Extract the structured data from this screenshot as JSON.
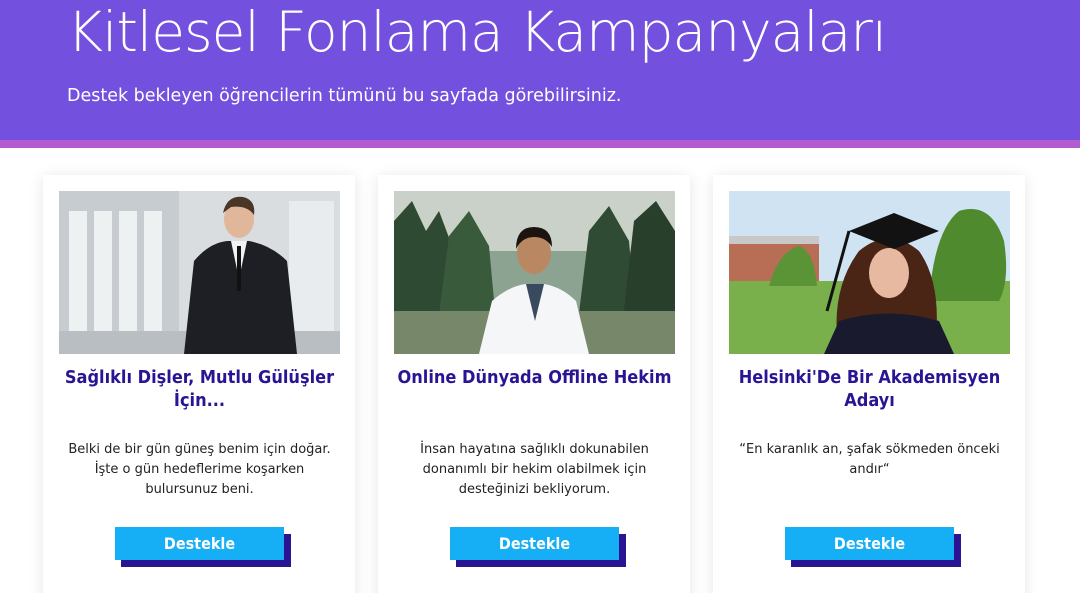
{
  "header": {
    "title": "Kitlesel Fonlama Kampanyaları",
    "subtitle": "Destek bekleyen öğrencilerin tümünü bu sayfada görebilirsiniz."
  },
  "colors": {
    "hero_bg": "#7350dd",
    "hero_stripe": "#b35ccf",
    "title_text": "#2a1494",
    "button_bg": "#16aef5",
    "button_shadow": "#2a1494"
  },
  "campaigns": [
    {
      "title": "Sağlıklı Dişler, Mutlu Gülüşler İçin...",
      "description": "Belki de bir gün güneş benim için doğar. İşte o gün hedeflerime koşarken bulursunuz beni.",
      "button_label": "Destekle",
      "image": "student-in-suit-photo"
    },
    {
      "title": "Online Dünyada Offline Hekim",
      "description": "İnsan hayatına sağlıklı dokunabilen donanımlı bir hekim olabilmek için desteğinizi bekliyorum.",
      "button_label": "Destekle",
      "image": "student-in-lab-coat-photo"
    },
    {
      "title": "Helsinki'De Bir Akademisyen Adayı",
      "description": "“En karanlık an, şafak sökmeden önceki andır“",
      "button_label": "Destekle",
      "image": "graduate-in-cap-photo"
    }
  ]
}
